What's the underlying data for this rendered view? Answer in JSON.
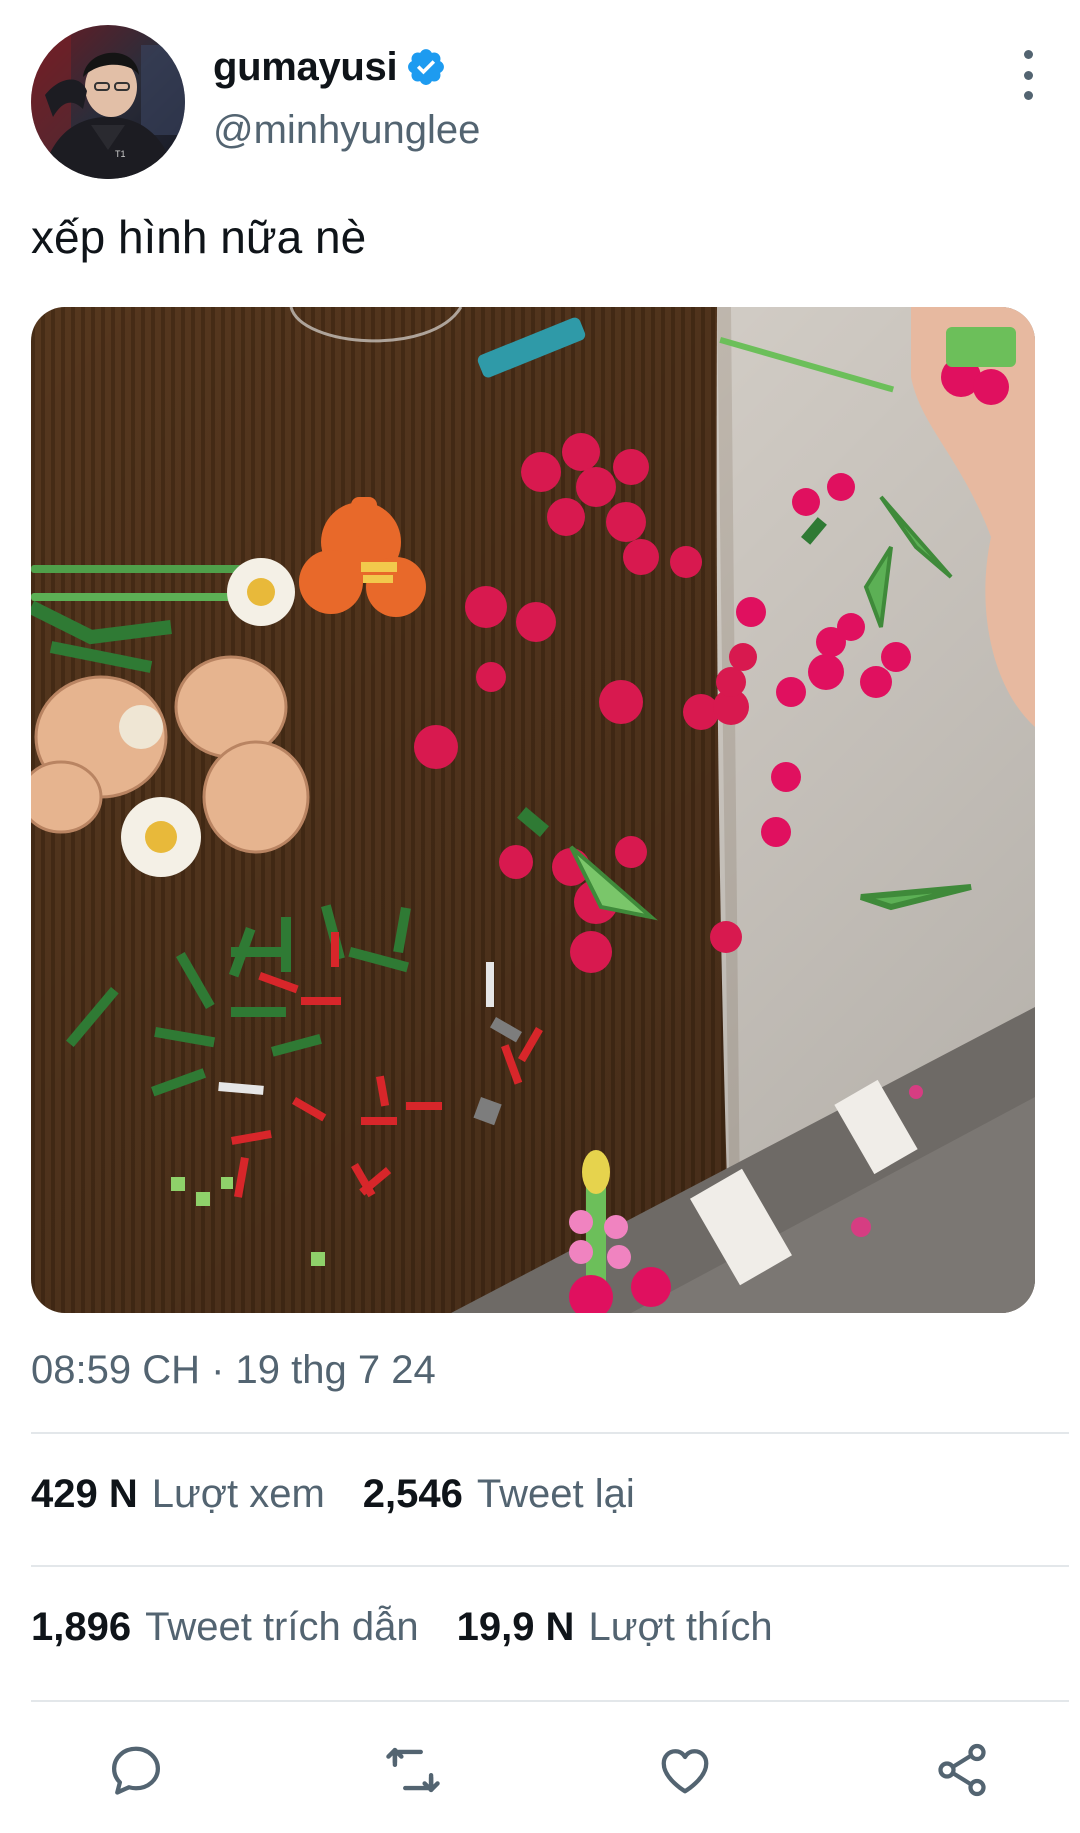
{
  "author": {
    "display_name": "gumayusi",
    "handle": "@minhyunglee",
    "verified": true,
    "verified_color": "#1d9bf0",
    "avatar_icon": "profile-photo"
  },
  "menu": {
    "more_icon": "more-vertical-icon"
  },
  "tweet": {
    "text": "xếp hình nữa nè",
    "photo_icon": "lego-flowers-photo",
    "timestamp": "08:59 CH · 19 thg 7 24"
  },
  "stats": {
    "views": {
      "count": "429 N",
      "label": "Lượt xem"
    },
    "retweets": {
      "count": "2,546",
      "label": "Tweet lại"
    },
    "quotes": {
      "count": "1,896",
      "label": "Tweet trích dẫn"
    },
    "likes": {
      "count": "19,9 N",
      "label": "Lượt thích"
    }
  },
  "actions": [
    {
      "icon": "reply-icon"
    },
    {
      "icon": "retweet-icon"
    },
    {
      "icon": "like-icon"
    },
    {
      "icon": "share-icon"
    }
  ],
  "colors": {
    "text_primary": "#0f1419",
    "text_secondary": "#536471",
    "divider": "#e3e7ea",
    "icon": "#536471"
  }
}
